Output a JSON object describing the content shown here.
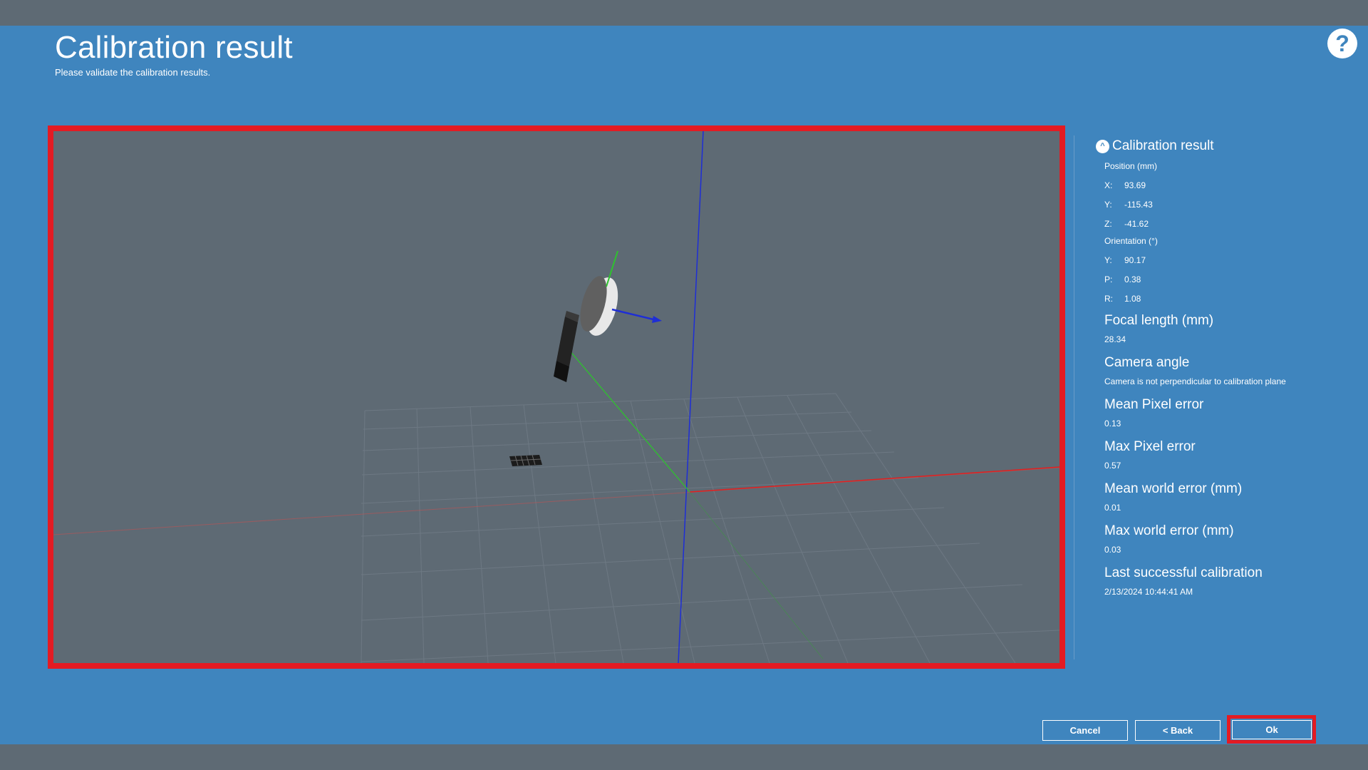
{
  "header": {
    "title": "Calibration result",
    "subtitle": "Please validate the calibration results.",
    "help_icon": "question-mark-icon"
  },
  "panel": {
    "title": "Calibration result",
    "collapse_icon": "chevron-up-icon",
    "position_label": "Position (mm)",
    "position": [
      {
        "key": "X:",
        "value": "93.69"
      },
      {
        "key": "Y:",
        "value": "-115.43"
      },
      {
        "key": "Z:",
        "value": "-41.62"
      }
    ],
    "orientation_label": "Orientation (°)",
    "orientation": [
      {
        "key": "Y:",
        "value": "90.17"
      },
      {
        "key": "P:",
        "value": "0.38"
      },
      {
        "key": "R:",
        "value": "1.08"
      }
    ],
    "sections": [
      {
        "heading": "Focal length (mm)",
        "value": "28.34"
      },
      {
        "heading": "Camera angle",
        "value": "Camera is not perpendicular to calibration plane"
      },
      {
        "heading": "Mean Pixel error",
        "value": "0.13"
      },
      {
        "heading": "Max Pixel error",
        "value": "0.57"
      },
      {
        "heading": "Mean world error (mm)",
        "value": "0.01"
      },
      {
        "heading": "Max world error (mm)",
        "value": "0.03"
      },
      {
        "heading": "Last successful calibration",
        "value": "2/13/2024 10:44:41 AM"
      }
    ]
  },
  "buttons": {
    "cancel": "Cancel",
    "back": "< Back",
    "ok": "Ok"
  },
  "colors": {
    "background": "#3f85be",
    "viewport": "#5e6a74",
    "highlight": "#e31b23",
    "axis_x": "#e02020",
    "axis_y": "#2ec22e",
    "axis_z": "#1e2ed6"
  }
}
